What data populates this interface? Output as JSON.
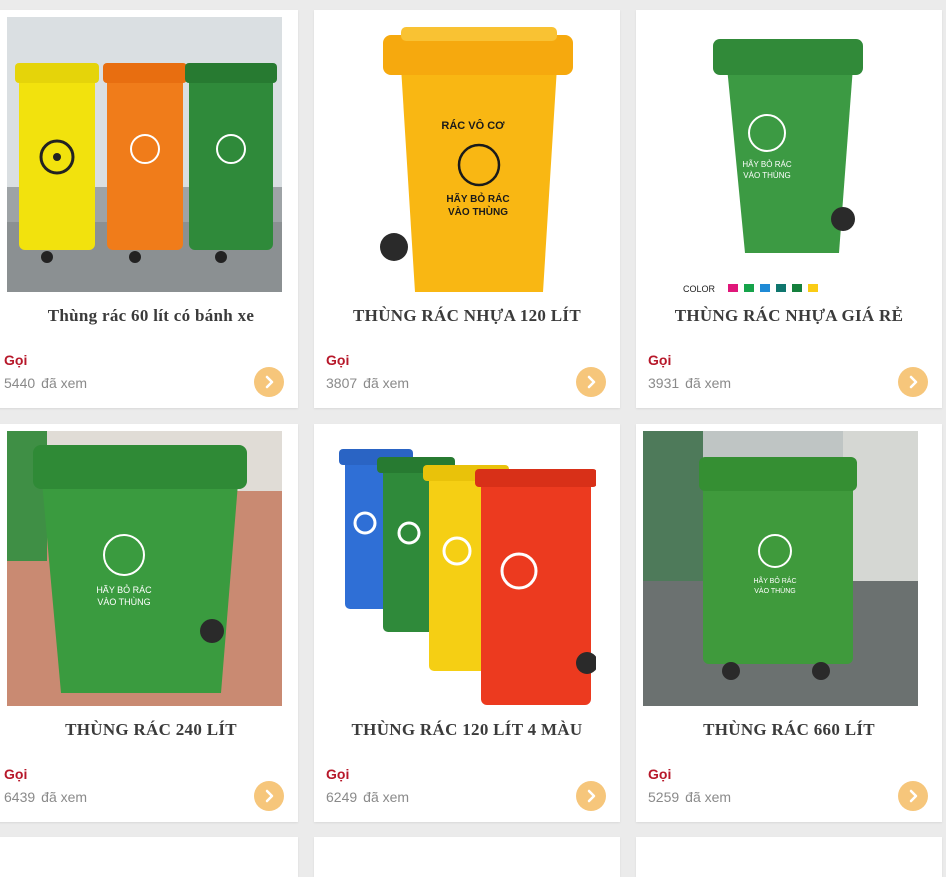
{
  "products": [
    {
      "title": "Thùng rác 60 lít có bánh xe",
      "price": "Gọi",
      "views": "5440",
      "views_suffix": "đã xem",
      "image_icon": "trash-bins-60l-three-colors-image"
    },
    {
      "title": "THÙNG RÁC NHỰA 120 LÍT",
      "price": "Gọi",
      "views": "3807",
      "views_suffix": "đã xem",
      "image_icon": "yellow-bin-120l-image",
      "bin_text_top": "RÁC VÔ CƠ",
      "bin_text_bottom_1": "HÃY BỎ RÁC",
      "bin_text_bottom_2": "VÀO THÙNG"
    },
    {
      "title": "THÙNG RÁC NHỰA GIÁ RẺ",
      "price": "Gọi",
      "views": "3931",
      "views_suffix": "đã xem",
      "image_icon": "green-bin-cheap-image",
      "color_label": "COLOR",
      "bin_text_1": "HÃY BỎ RÁC",
      "bin_text_2": "VÀO THÙNG"
    },
    {
      "title": "THÙNG RÁC 240 LÍT",
      "price": "Gọi",
      "views": "6439",
      "views_suffix": "đã xem",
      "image_icon": "green-bin-240l-image",
      "bin_text_1": "HÃY BỎ RÁC",
      "bin_text_2": "VÀO THÙNG"
    },
    {
      "title": "THÙNG RÁC 120 LÍT 4 MÀU",
      "price": "Gọi",
      "views": "6249",
      "views_suffix": "đã xem",
      "image_icon": "four-color-bins-image"
    },
    {
      "title": "THÙNG RÁC 660 LÍT",
      "price": "Gọi",
      "views": "5259",
      "views_suffix": "đã xem",
      "image_icon": "green-bin-660l-image",
      "bin_text_1": "HÃY BỎ RÁC",
      "bin_text_2": "VÀO THÙNG"
    }
  ],
  "colors": {
    "price": "#b7182a",
    "arrow_button": "#f6c67b",
    "swatches": [
      "#e0177a",
      "#16a34a",
      "#1f8ad6",
      "#0f766e",
      "#15803d",
      "#facc15"
    ]
  }
}
